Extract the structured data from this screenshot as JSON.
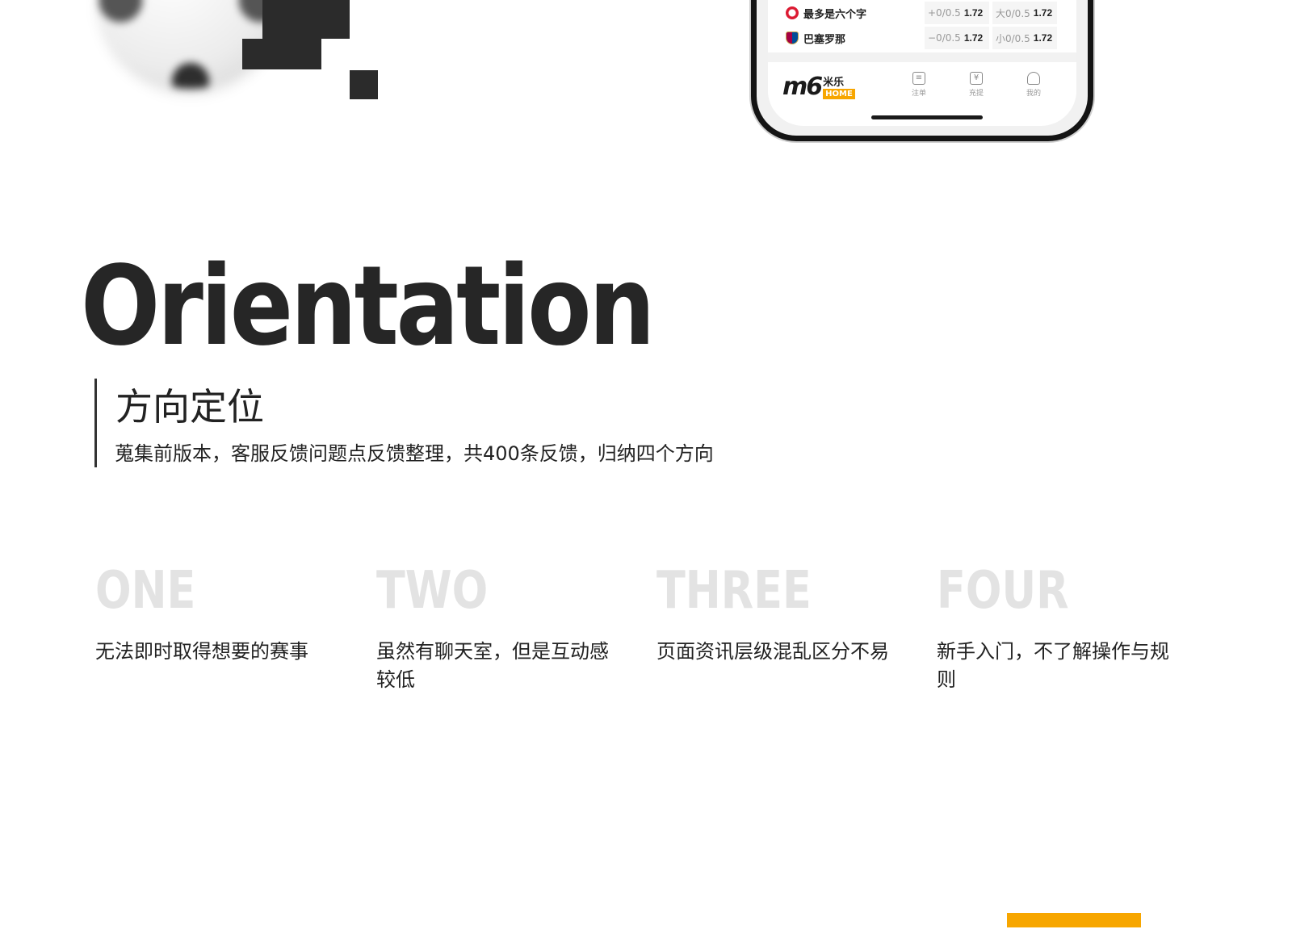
{
  "phone": {
    "matches": [
      {
        "team": "最多是六个字",
        "badge": "bayern-crest-icon",
        "handicap": "+0/0.5",
        "handicap_odds": "1.72",
        "total": "大0/0.5",
        "total_odds": "1.72"
      },
      {
        "team": "巴塞罗那",
        "badge": "barca-crest-icon",
        "handicap": "−0/0.5",
        "handicap_odds": "1.72",
        "total": "小0/0.5",
        "total_odds": "1.72"
      }
    ],
    "logo": {
      "mark": "m6",
      "cn": "米乐",
      "home": "HOME"
    },
    "tabs": [
      {
        "label": "注单",
        "icon": "slip-icon"
      },
      {
        "label": "充提",
        "icon": "wallet-icon"
      },
      {
        "label": "我的",
        "icon": "user-icon"
      }
    ]
  },
  "heading": {
    "en": "Orientation",
    "cn": "方向定位",
    "subtitle": "蒐集前版本，客服反馈问题点反馈整理，共400条反馈，归纳四个方向"
  },
  "points": [
    {
      "num": "ONE",
      "desc": "无法即时取得想要的赛事"
    },
    {
      "num": "TWO",
      "desc": "虽然有聊天室，但是互动感较低"
    },
    {
      "num": "THREE",
      "desc": "页面资讯层级混乱区分不易"
    },
    {
      "num": "FOUR",
      "desc": "新手入门，不了解操作与规则"
    }
  ],
  "colors": {
    "accent": "#f7a600",
    "dark": "#262626",
    "muted_number": "#e3e3e3"
  }
}
